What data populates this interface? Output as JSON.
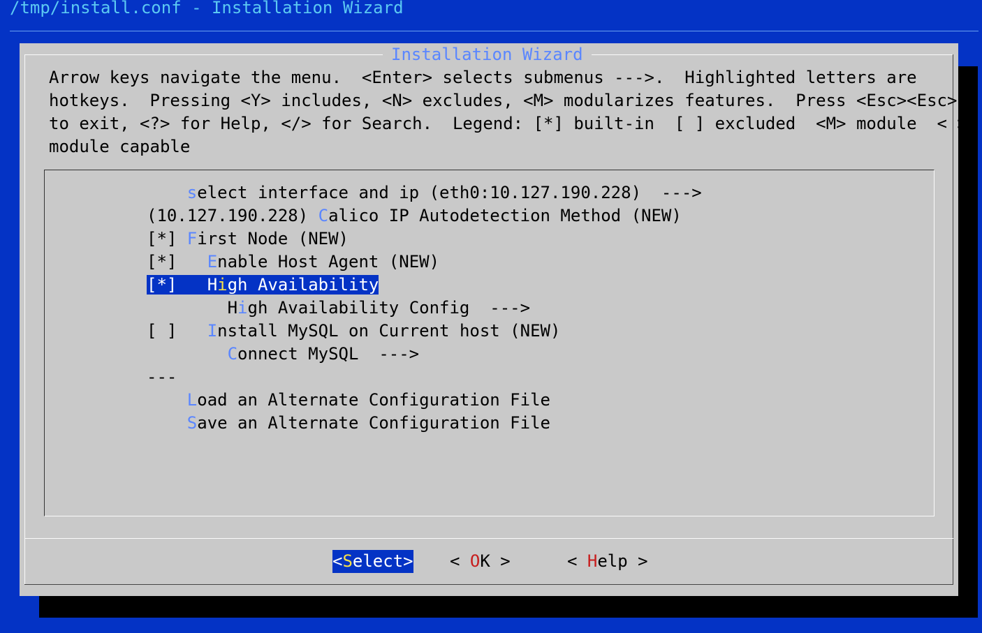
{
  "window": {
    "title": "/tmp/install.conf - Installation Wizard"
  },
  "dialog": {
    "title": "Installation Wizard",
    "help_lines": [
      "Arrow keys navigate the menu.  <Enter> selects submenus --->.  Highlighted letters are",
      "hotkeys.  Pressing <Y> includes, <N> excludes, <M> modularizes features.  Press <Esc><Esc>",
      "to exit, <?> for Help, </> for Search.  Legend: [*] built-in  [ ] excluded  <M> module  < >",
      "module capable"
    ]
  },
  "menu": {
    "items": [
      {
        "prefix": "    ",
        "hotkey": "s",
        "rest": "elect interface and ip (eth0:10.127.190.228)  --->",
        "selected": false
      },
      {
        "prefix": "(10.127.190.228) ",
        "hotkey": "C",
        "rest": "alico IP Autodetection Method (NEW)",
        "selected": false
      },
      {
        "prefix": "[*] ",
        "hotkey": "F",
        "rest": "irst Node (NEW)",
        "selected": false
      },
      {
        "prefix": "[*]   ",
        "hotkey": "E",
        "rest": "nable Host Agent (NEW)",
        "selected": false
      },
      {
        "prefix": "[*]   ",
        "hotkey": "i",
        "pre_hotkey": "H",
        "rest": "gh Availability",
        "selected": true
      },
      {
        "prefix": "        ",
        "hotkey": "i",
        "pre_hotkey": "H",
        "rest": "gh Availability Config  --->",
        "selected": false
      },
      {
        "prefix": "[ ]   ",
        "hotkey": "I",
        "rest": "nstall MySQL on Current host (NEW)",
        "selected": false
      },
      {
        "prefix": "        ",
        "hotkey": "C",
        "rest": "onnect MySQL  --->",
        "selected": false
      }
    ],
    "separator": "---",
    "file_items": [
      {
        "prefix": "    ",
        "hotkey": "L",
        "rest": "oad an Alternate Configuration File"
      },
      {
        "prefix": "    ",
        "hotkey": "S",
        "rest": "ave an Alternate Configuration File"
      }
    ]
  },
  "buttons": {
    "select": {
      "open": "<",
      "hotkey": "S",
      "rest": "elect",
      "close": ">"
    },
    "ok": {
      "open": "< ",
      "hotkey": "O",
      "rest": "K",
      "close": " >"
    },
    "help": {
      "open": "< ",
      "hotkey": "H",
      "rest": "elp",
      "close": " >"
    }
  },
  "colors": {
    "background": "#0433c5",
    "dialog": "#c9c9c9",
    "hotkey": "#5a86ff",
    "selected_bg": "#0433c5",
    "selected_hotkey": "#f8e04a",
    "button_hotkey": "#c71c1c",
    "window_title": "#5cc9f2"
  }
}
